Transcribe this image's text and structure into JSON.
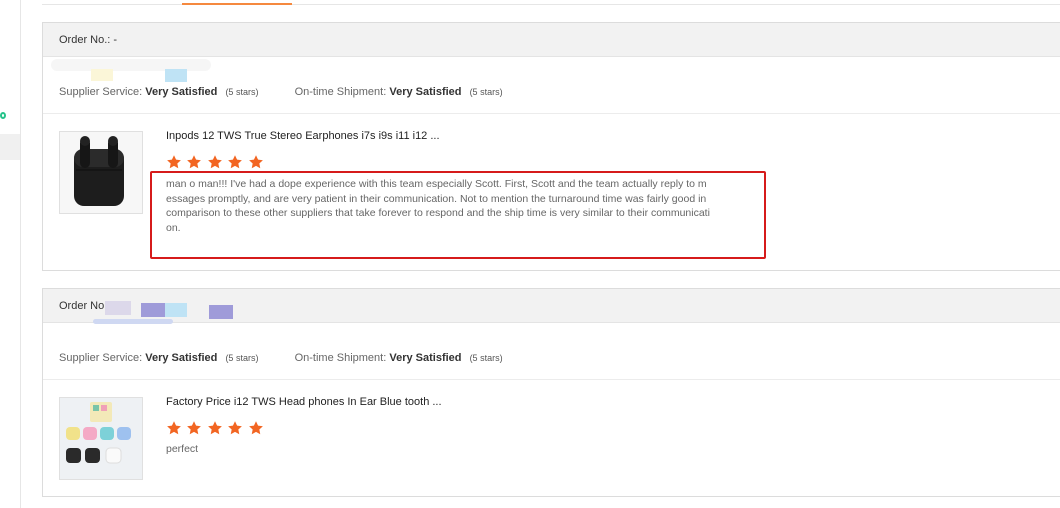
{
  "colors": {
    "star": "#f26522",
    "highlight": "#d61b1b",
    "active_tab": "#f5893f"
  },
  "orders": [
    {
      "order_label": "Order No.: -",
      "supplier_service_label": "Supplier Service:",
      "supplier_service_value": "Very Satisfied",
      "supplier_service_stars": "(5 stars)",
      "shipment_label": "On-time Shipment:",
      "shipment_value": "Very Satisfied",
      "shipment_stars": "(5 stars)",
      "product_title": "Inpods 12 TWS True Stereo Earphones i7s i9s i11 i12 ...",
      "rating": 5,
      "review_text": "man o man!!! I've had a dope experience with this team especially Scott. First, Scott and the team actually reply to messages promptly, and are very patient in their communication. Not to mention the turnaround time was fairly good in comparison to these other suppliers that  take forever to respond and the ship time is very similar to their communication.",
      "image_icon": "black-earbuds-case-icon"
    },
    {
      "order_label": "Order No",
      "supplier_service_label": "Supplier Service:",
      "supplier_service_value": "Very Satisfied",
      "supplier_service_stars": "(5 stars)",
      "shipment_label": "On-time Shipment:",
      "shipment_value": "Very Satisfied",
      "shipment_stars": "(5 stars)",
      "product_title": "Factory Price i12 TWS Head phones In Ear Blue tooth ...",
      "rating": 5,
      "review_text": "perfect",
      "image_icon": "colorful-earbuds-cases-icon"
    }
  ]
}
